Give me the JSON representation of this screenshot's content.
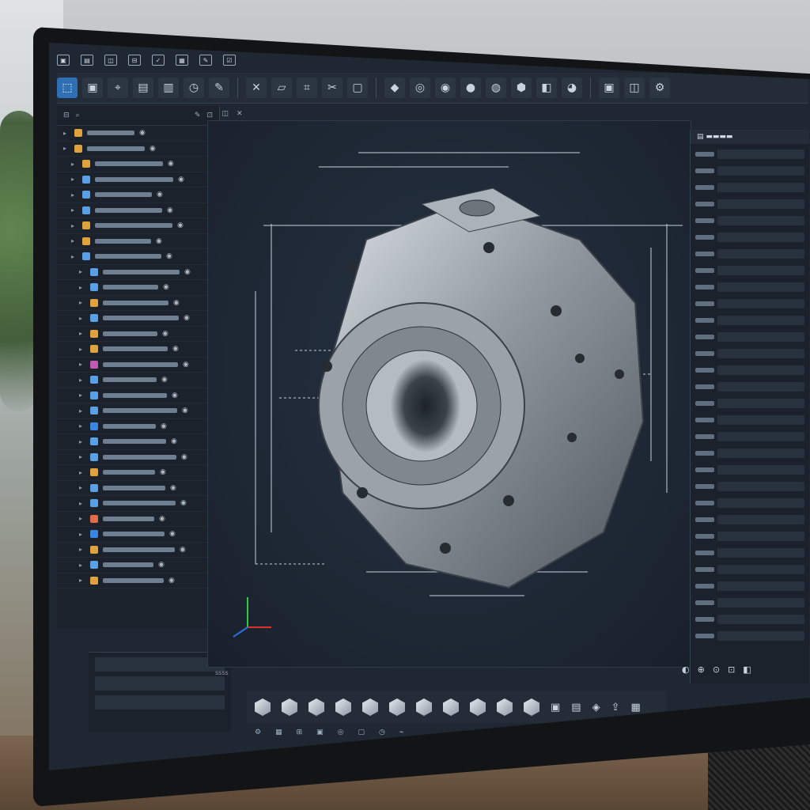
{
  "app": {
    "viewport_label": "ssss",
    "colors": {
      "accent": "#2f6fb3",
      "panel": "#1b222b",
      "viewport": "#1f2732"
    }
  },
  "menubar": {
    "icons": [
      "file-icon",
      "edit-icon",
      "view-icon",
      "insert-icon",
      "tools-icon",
      "window-icon",
      "help-icon",
      "check-icon"
    ]
  },
  "toolbar": {
    "icons": [
      "select-icon",
      "cube-icon",
      "pin-icon",
      "part-icon",
      "component-icon",
      "clock-icon",
      "pencil-icon",
      "trim-icon",
      "sketch-icon",
      "pattern-icon",
      "cut-icon",
      "box-icon",
      "solid-icon",
      "circle-icon",
      "ring-icon",
      "hole-icon",
      "shell-icon",
      "body-icon",
      "block-icon",
      "sphere-icon",
      "view-cube-icon",
      "display-icon",
      "settings-icon"
    ]
  },
  "tree": {
    "rows": [
      {
        "indent": 0,
        "color": "#e0a23c"
      },
      {
        "indent": 0,
        "color": "#e0a23c"
      },
      {
        "indent": 1,
        "color": "#e0a23c"
      },
      {
        "indent": 1,
        "color": "#5aa0e6"
      },
      {
        "indent": 1,
        "color": "#5aa0e6"
      },
      {
        "indent": 1,
        "color": "#5aa0e6"
      },
      {
        "indent": 1,
        "color": "#e0a23c"
      },
      {
        "indent": 1,
        "color": "#e0a23c"
      },
      {
        "indent": 1,
        "color": "#5aa0e6"
      },
      {
        "indent": 2,
        "color": "#5aa0e6"
      },
      {
        "indent": 2,
        "color": "#5aa0e6"
      },
      {
        "indent": 2,
        "color": "#e0a23c"
      },
      {
        "indent": 2,
        "color": "#5aa0e6"
      },
      {
        "indent": 2,
        "color": "#e0a23c"
      },
      {
        "indent": 2,
        "color": "#e0a23c"
      },
      {
        "indent": 2,
        "color": "#c05ab0"
      },
      {
        "indent": 2,
        "color": "#5aa0e6"
      },
      {
        "indent": 2,
        "color": "#5aa0e6"
      },
      {
        "indent": 2,
        "color": "#5aa0e6"
      },
      {
        "indent": 2,
        "color": "#3a86e0"
      },
      {
        "indent": 2,
        "color": "#5aa0e6"
      },
      {
        "indent": 2,
        "color": "#5aa0e6"
      },
      {
        "indent": 2,
        "color": "#e0a23c"
      },
      {
        "indent": 2,
        "color": "#5aa0e6"
      },
      {
        "indent": 2,
        "color": "#5aa0e6"
      },
      {
        "indent": 2,
        "color": "#e06a4a"
      },
      {
        "indent": 2,
        "color": "#3a86e0"
      },
      {
        "indent": 2,
        "color": "#e0a23c"
      },
      {
        "indent": 2,
        "color": "#5aa0e6"
      },
      {
        "indent": 2,
        "color": "#e0a23c"
      }
    ]
  },
  "bottom": {
    "shape_icons": [
      "box-shape-icon",
      "cylinder-shape-icon",
      "cube-shape-icon",
      "prism-shape-icon",
      "hex-shape-icon",
      "cube2-shape-icon",
      "cube3-shape-icon",
      "mesh-icon",
      "mesh2-icon",
      "mesh3-icon",
      "solid-shape-icon",
      "save-icon",
      "doc-icon",
      "lock-icon",
      "export-icon",
      "image-icon"
    ]
  }
}
